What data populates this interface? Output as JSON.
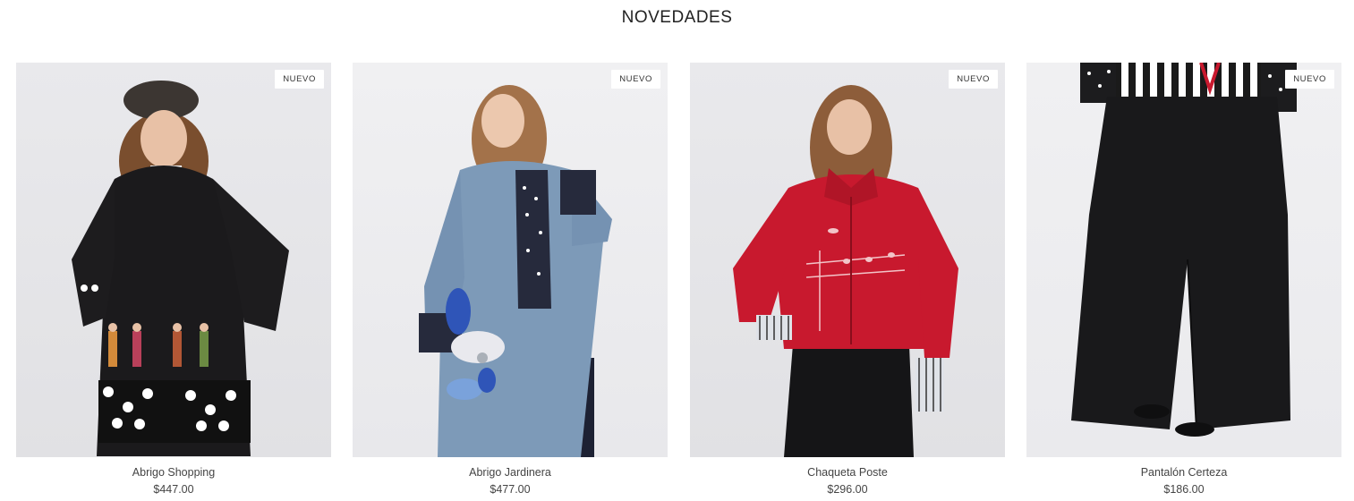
{
  "section": {
    "title": "NOVEDADES"
  },
  "products": [
    {
      "name": "Abrigo Shopping",
      "price": "$447.00",
      "badge": "NUEVO"
    },
    {
      "name": "Abrigo Jardinera",
      "price": "$477.00",
      "badge": "NUEVO"
    },
    {
      "name": "Chaqueta Poste",
      "price": "$296.00",
      "badge": "NUEVO"
    },
    {
      "name": "Pantalón Certeza",
      "price": "$186.00",
      "badge": "NUEVO"
    }
  ],
  "colors": {
    "badge_bg": "#ffffff",
    "photo_bg": "#e5e5e8",
    "text": "#444444"
  }
}
